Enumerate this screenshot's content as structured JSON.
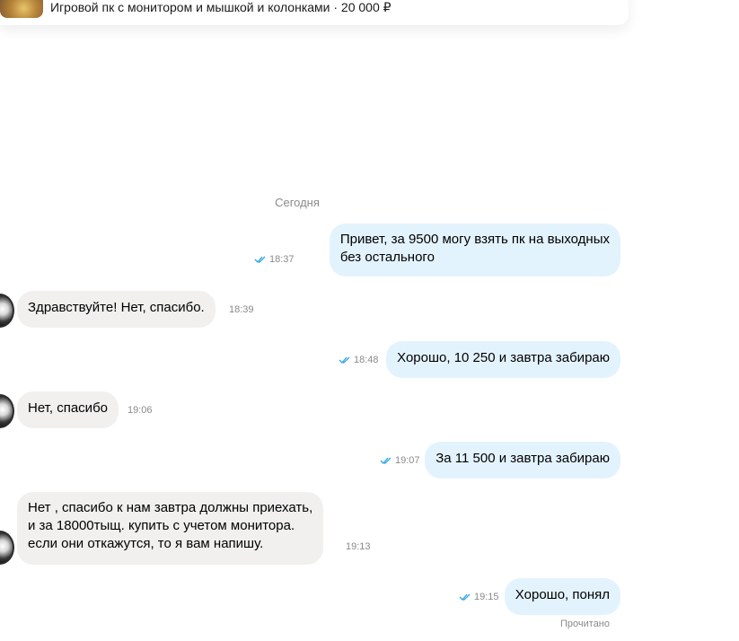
{
  "listing": {
    "title": "Игровой пк с монитором и мышкой и колонками · 20 000 ₽"
  },
  "date_separator": "Сегодня",
  "messages": [
    {
      "direction": "out",
      "lines": [
        "Привет, за 9500 могу взять пк на выходных",
        "без остального"
      ],
      "time": "18:37"
    },
    {
      "direction": "in",
      "lines": [
        "Здравствуйте! Нет, спасибо."
      ],
      "time": "18:39"
    },
    {
      "direction": "out",
      "lines": [
        "Хорошо, 10 250 и завтра забираю"
      ],
      "time": "18:48"
    },
    {
      "direction": "in",
      "lines": [
        "Нет, спасибо"
      ],
      "time": "19:06"
    },
    {
      "direction": "out",
      "lines": [
        "За 11 500 и завтра забираю"
      ],
      "time": "19:07"
    },
    {
      "direction": "in",
      "lines": [
        "Нет , спасибо к нам завтра должны приехать,",
        "и за 18000тыщ. купить с учетом монитора.",
        "если они откажутся, то я вам напишу."
      ],
      "time": "19:13"
    },
    {
      "direction": "out",
      "lines": [
        "Хорошо, понял"
      ],
      "time": "19:15"
    }
  ],
  "read_status": "Прочитано",
  "colors": {
    "outgoing_bubble": "#e3f3fd",
    "incoming_bubble": "#f1f0ef",
    "read_check": "#2fa3e6",
    "meta_text": "#8a8a8a"
  },
  "icons": {
    "read_receipt": "double-check-icon",
    "contact_avatar": "avatar"
  }
}
